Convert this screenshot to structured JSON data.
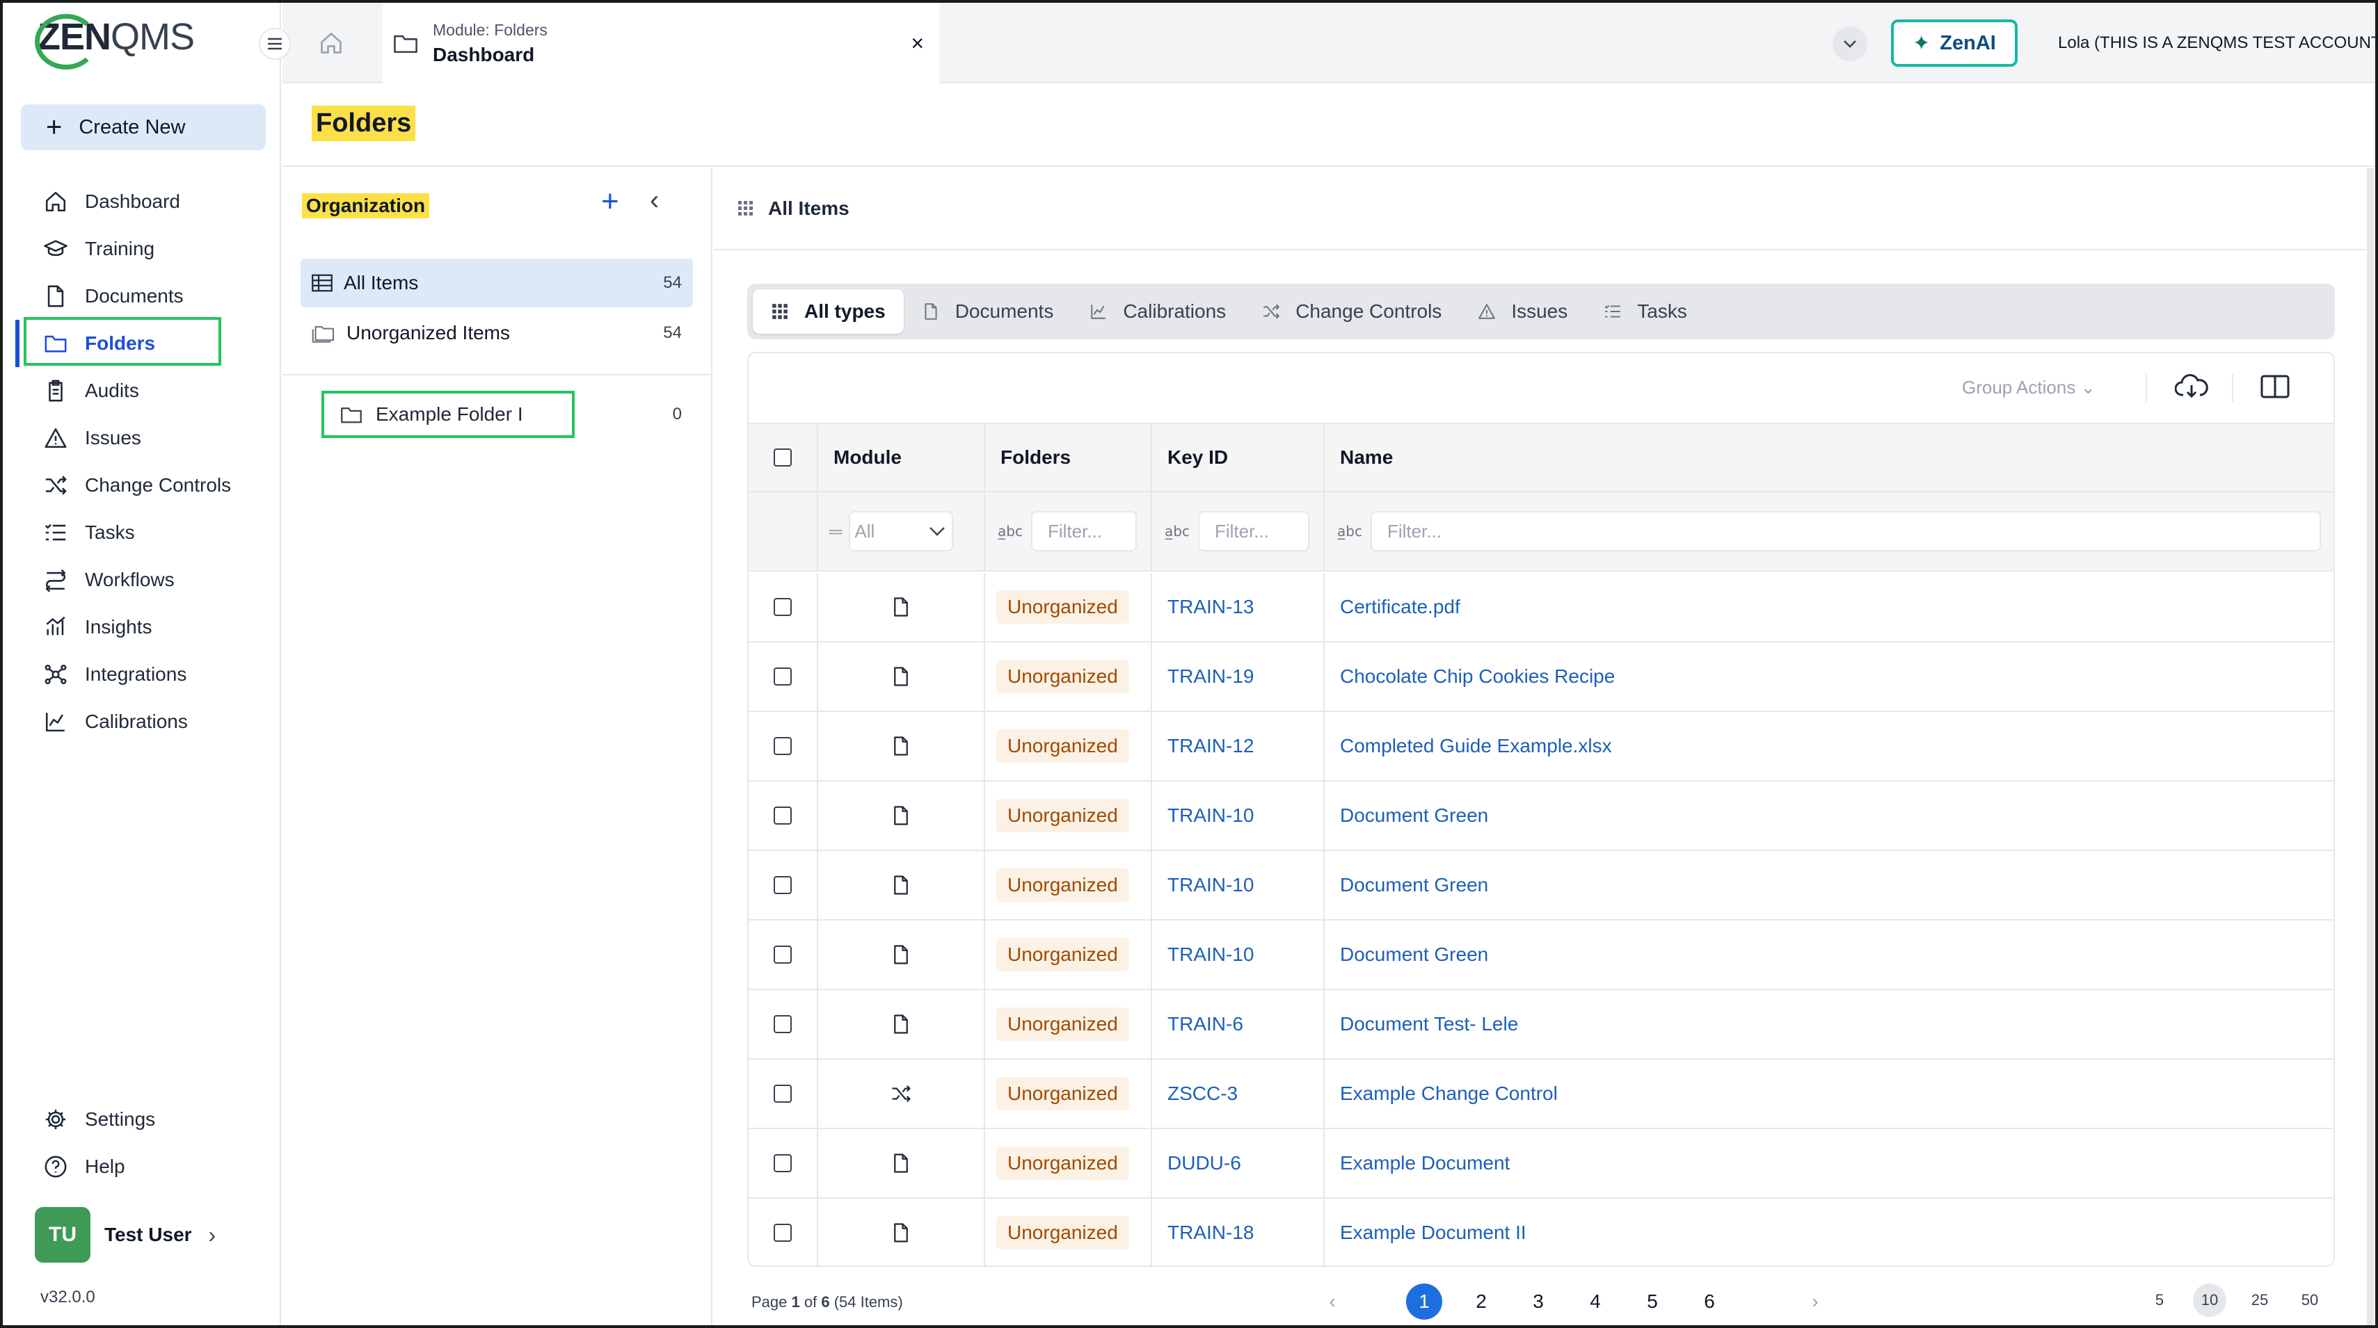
{
  "logo": {
    "zen": "ZEN",
    "qms": "QMS"
  },
  "create_label": "Create New",
  "nav": [
    {
      "label": "Dashboard",
      "icon": "home-icon"
    },
    {
      "label": "Training",
      "icon": "graduation-cap-icon"
    },
    {
      "label": "Documents",
      "icon": "document-icon"
    },
    {
      "label": "Folders",
      "icon": "folder-icon",
      "active": true
    },
    {
      "label": "Audits",
      "icon": "clipboard-icon"
    },
    {
      "label": "Issues",
      "icon": "warning-icon"
    },
    {
      "label": "Change Controls",
      "icon": "shuffle-icon"
    },
    {
      "label": "Tasks",
      "icon": "checklist-icon"
    },
    {
      "label": "Workflows",
      "icon": "workflow-icon"
    },
    {
      "label": "Insights",
      "icon": "insights-icon"
    },
    {
      "label": "Integrations",
      "icon": "integrations-icon"
    },
    {
      "label": "Calibrations",
      "icon": "chart-icon"
    }
  ],
  "bottom_nav": [
    {
      "label": "Settings",
      "icon": "gear-icon"
    },
    {
      "label": "Help",
      "icon": "help-icon"
    }
  ],
  "user": {
    "initials": "TU",
    "name": "Test User"
  },
  "version": "v32.0.0",
  "topbar": {
    "tab_sub": "Module: Folders",
    "tab_main": "Dashboard",
    "close": "×",
    "zenai": "ZenAI",
    "account": "Lola (THIS IS A ZENQMS TEST ACCOUNT)"
  },
  "page_title": "Folders",
  "org": {
    "title": "Organization",
    "items": [
      {
        "label": "All Items",
        "count": "54"
      },
      {
        "label": "Unorganized Items",
        "count": "54"
      }
    ],
    "folder": {
      "label": "Example Folder I",
      "count": "0"
    }
  },
  "main_head": "All Items",
  "type_tabs": [
    {
      "label": "All types",
      "icon": "grid-icon"
    },
    {
      "label": "Documents",
      "icon": "document-icon"
    },
    {
      "label": "Calibrations",
      "icon": "chart-icon"
    },
    {
      "label": "Change Controls",
      "icon": "shuffle-icon"
    },
    {
      "label": "Issues",
      "icon": "warning-icon"
    },
    {
      "label": "Tasks",
      "icon": "checklist-icon"
    }
  ],
  "toolbar": {
    "group_actions": "Group Actions"
  },
  "table": {
    "headers": {
      "module": "Module",
      "folders": "Folders",
      "key": "Key ID",
      "name": "Name"
    },
    "filters": {
      "module": "All",
      "folders": "Filter...",
      "key": "Filter...",
      "name": "Filter..."
    },
    "rows": [
      {
        "module_icon": "document-icon",
        "folder": "Unorganized",
        "key": "TRAIN-13",
        "name": "Certificate.pdf"
      },
      {
        "module_icon": "document-icon",
        "folder": "Unorganized",
        "key": "TRAIN-19",
        "name": "Chocolate Chip Cookies Recipe"
      },
      {
        "module_icon": "document-icon",
        "folder": "Unorganized",
        "key": "TRAIN-12",
        "name": "Completed Guide Example.xlsx"
      },
      {
        "module_icon": "document-icon",
        "folder": "Unorganized",
        "key": "TRAIN-10",
        "name": "Document Green"
      },
      {
        "module_icon": "document-icon",
        "folder": "Unorganized",
        "key": "TRAIN-10",
        "name": "Document Green"
      },
      {
        "module_icon": "document-icon",
        "folder": "Unorganized",
        "key": "TRAIN-10",
        "name": "Document Green"
      },
      {
        "module_icon": "document-icon",
        "folder": "Unorganized",
        "key": "TRAIN-6",
        "name": "Document Test- Lele"
      },
      {
        "module_icon": "shuffle-icon",
        "folder": "Unorganized",
        "key": "ZSCC-3",
        "name": "Example Change Control"
      },
      {
        "module_icon": "document-icon",
        "folder": "Unorganized",
        "key": "DUDU-6",
        "name": "Example Document"
      },
      {
        "module_icon": "document-icon",
        "folder": "Unorganized",
        "key": "TRAIN-18",
        "name": "Example Document II"
      }
    ]
  },
  "footer": {
    "page_prefix": "Page ",
    "page_current": "1",
    "page_of": " of ",
    "page_total": "6",
    "items_text": " (54 Items)",
    "pages": [
      "1",
      "2",
      "3",
      "4",
      "5",
      "6"
    ],
    "sizes": [
      "5",
      "10",
      "25",
      "50"
    ],
    "size_selected": "10"
  },
  "colors": {
    "accent": "#1d6fe0",
    "highlight": "#fde047",
    "callout": "#22c55e",
    "brand": "#3f9a57"
  }
}
